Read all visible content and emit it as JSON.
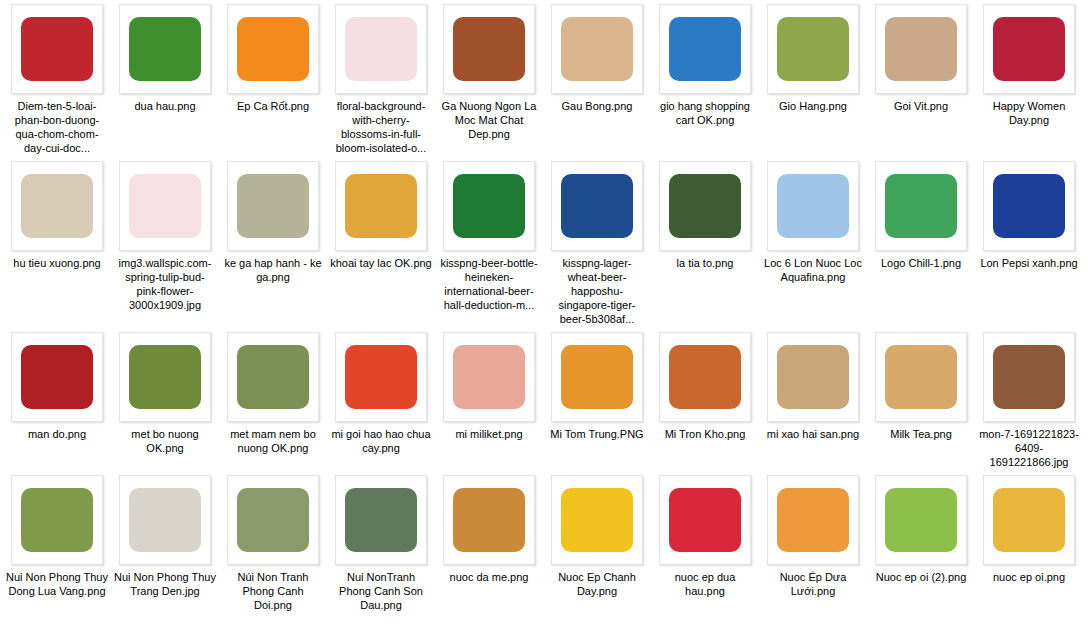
{
  "files": [
    {
      "name": "Diem-ten-5-loai-phan-bon-duong-qua-chom-chom-day-cui-doc...",
      "color": "#c0262d"
    },
    {
      "name": "dua hau.png",
      "color": "#3f8f2e"
    },
    {
      "name": "Ep Ca Rốt.png",
      "color": "#f28a1c"
    },
    {
      "name": "floral-background-with-cherry-blossoms-in-full-bloom-isolated-o...",
      "color": "#f6dfe3"
    },
    {
      "name": "Ga Nuong Ngon La Moc Mat Chat Dep.png",
      "color": "#a0502a"
    },
    {
      "name": "Gau Bong.png",
      "color": "#d9b48c"
    },
    {
      "name": "gio hang shopping cart OK.png",
      "color": "#2a7bc4"
    },
    {
      "name": "Gio Hang.png",
      "color": "#8fa64a"
    },
    {
      "name": "Goi Vit.png",
      "color": "#c9a98a"
    },
    {
      "name": "Happy Women Day.png",
      "color": "#b8203a"
    },
    {
      "name": "hu tieu xuong.png",
      "color": "#d8cbb5"
    },
    {
      "name": "img3.wallspic.com-spring-tulip-bud-pink-flower-3000x1909.jpg",
      "color": "#f7dfe6"
    },
    {
      "name": "ke ga hap hanh - ke ga.png",
      "color": "#b5b29a"
    },
    {
      "name": "khoai tay lac OK.png",
      "color": "#e0a63a"
    },
    {
      "name": "kisspng-beer-bottle-heineken-international-beer-hall-deduction-m...",
      "color": "#1f7a36"
    },
    {
      "name": "kisspng-lager-wheat-beer-happoshu-singapore-tiger-beer-5b308af...",
      "color": "#1d4d8f"
    },
    {
      "name": "la tia to.png",
      "color": "#3f5b34"
    },
    {
      "name": "Loc 6 Lon Nuoc Loc Aquafina.png",
      "color": "#9fc6e8"
    },
    {
      "name": "Logo Chill-1.png",
      "color": "#3fa55a"
    },
    {
      "name": "Lon Pepsi xanh.png",
      "color": "#1c3f9a"
    },
    {
      "name": "man do.png",
      "color": "#b01f24"
    },
    {
      "name": "met bo nuong OK.png",
      "color": "#6f8a3a"
    },
    {
      "name": "met mam nem bo nuong OK.png",
      "color": "#7c8f55"
    },
    {
      "name": "mi goi hao hao chua cay.png",
      "color": "#e2452a"
    },
    {
      "name": "mi miliket.png",
      "color": "#e9a79a"
    },
    {
      "name": "Mi Tom Trung.PNG",
      "color": "#e6952c"
    },
    {
      "name": "Mi Tron Kho.png",
      "color": "#c9682e"
    },
    {
      "name": "mi xao hai san.png",
      "color": "#c8a67a"
    },
    {
      "name": "Milk Tea.png",
      "color": "#d9a96b"
    },
    {
      "name": "mon-7-1691221823-6409-1691221866.jpg",
      "color": "#8a5a3a"
    },
    {
      "name": "Nui Non Phong Thuy Dong Lua Vang.png",
      "color": "#7f9a4a"
    },
    {
      "name": "Nui Non Phong Thuy Trang Den.jpg",
      "color": "#d8d4cc"
    },
    {
      "name": "Núi Non Tranh Phong Canh Doi.png",
      "color": "#8a9a6a"
    },
    {
      "name": "Nui NonTranh Phong Canh Son Dau.png",
      "color": "#5f7a5a"
    },
    {
      "name": "nuoc da me.png",
      "color": "#c98a3a"
    },
    {
      "name": "Nuoc Ep Chanh Day.png",
      "color": "#f2c21e"
    },
    {
      "name": "nuoc ep dua hau.png",
      "color": "#d8283a"
    },
    {
      "name": "Nuoc Ép Dưa Lưới.png",
      "color": "#ee9a3c"
    },
    {
      "name": "Nuoc ep oi (2).png",
      "color": "#8cc04a"
    },
    {
      "name": "nuoc ep oi.png",
      "color": "#e8b63a"
    }
  ]
}
